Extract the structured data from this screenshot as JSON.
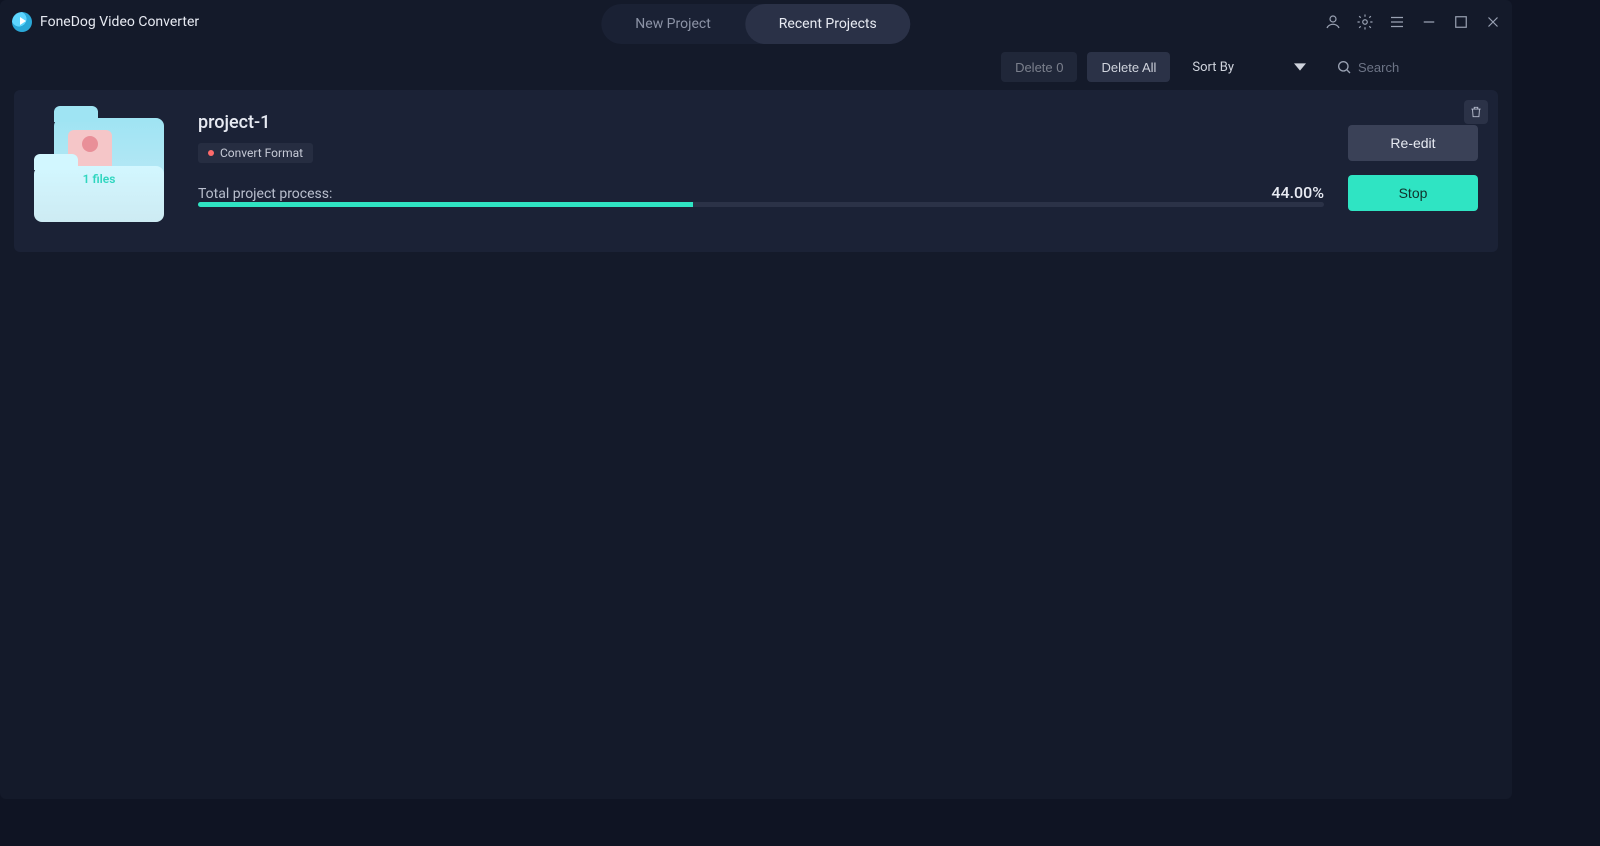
{
  "app": {
    "title": "FoneDog Video Converter"
  },
  "tabs": {
    "new": "New Project",
    "recent": "Recent Projects"
  },
  "toolbar": {
    "delete_label": "Delete 0",
    "delete_all_label": "Delete All",
    "sort_label": "Sort By",
    "search_placeholder": "Search"
  },
  "project": {
    "name": "project-1",
    "file_count_label": "1 files",
    "tag": "Convert Format",
    "progress_label": "Total project process:",
    "progress_pct_label": "44.00%",
    "progress_pct_value": 44,
    "reedit_label": "Re-edit",
    "stop_label": "Stop"
  }
}
